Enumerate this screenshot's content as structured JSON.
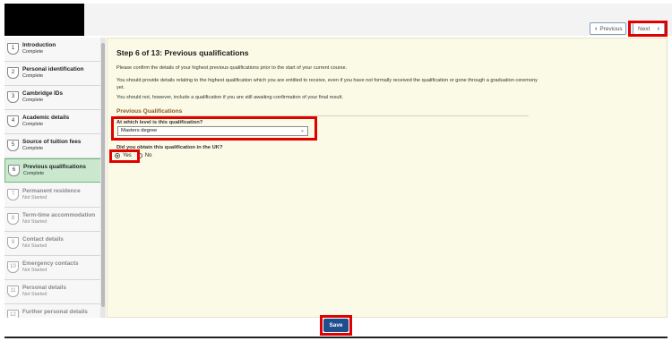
{
  "header": {
    "prev_label": "Previous",
    "next_label": "Next"
  },
  "sidebar": {
    "steps": [
      {
        "num": "1",
        "title": "Introduction",
        "status": "Complete"
      },
      {
        "num": "2",
        "title": "Personal identification",
        "status": "Complete"
      },
      {
        "num": "3",
        "title": "Cambridge IDs",
        "status": "Complete"
      },
      {
        "num": "4",
        "title": "Academic details",
        "status": "Complete"
      },
      {
        "num": "5",
        "title": "Source of tuition fees",
        "status": "Complete"
      },
      {
        "num": "6",
        "title": "Previous qualifications",
        "status": "Complete"
      },
      {
        "num": "7",
        "title": "Permanent residence",
        "status": "Not Started"
      },
      {
        "num": "8",
        "title": "Term-time accommodation",
        "status": "Not Started"
      },
      {
        "num": "9",
        "title": "Contact details",
        "status": "Not Started"
      },
      {
        "num": "10",
        "title": "Emergency contacts",
        "status": "Not Started"
      },
      {
        "num": "11",
        "title": "Personal details",
        "status": "Not Started"
      },
      {
        "num": "12",
        "title": "Further personal details",
        "status": ""
      }
    ]
  },
  "main": {
    "title": "Step 6 of 13: Previous qualifications",
    "para1": "Please confirm the details of your highest previous qualifications prior to the start of your current course.",
    "para2": "You should provide details relating to the highest qualification which you are entitled to receive, even if you have not formally received the qualification or gone through a graduation ceremony yet.",
    "para3": "You should not, however, include a qualification if you are still awaiting confirmation of your final result.",
    "section_title": "Previous Qualifications",
    "q_level": "At which level is this qualification?",
    "level_value": "Masters degree",
    "q_uk": "Did you obtain this qualification in the UK?",
    "yes_label": "Yes",
    "no_label": "No",
    "selected": "Yes"
  },
  "footer": {
    "save_label": "Save"
  },
  "colors": {
    "highlight": "#e10000",
    "active_step": "#c9e8cd",
    "save_button": "#1f4f8f",
    "content_bg": "#fafae6"
  }
}
